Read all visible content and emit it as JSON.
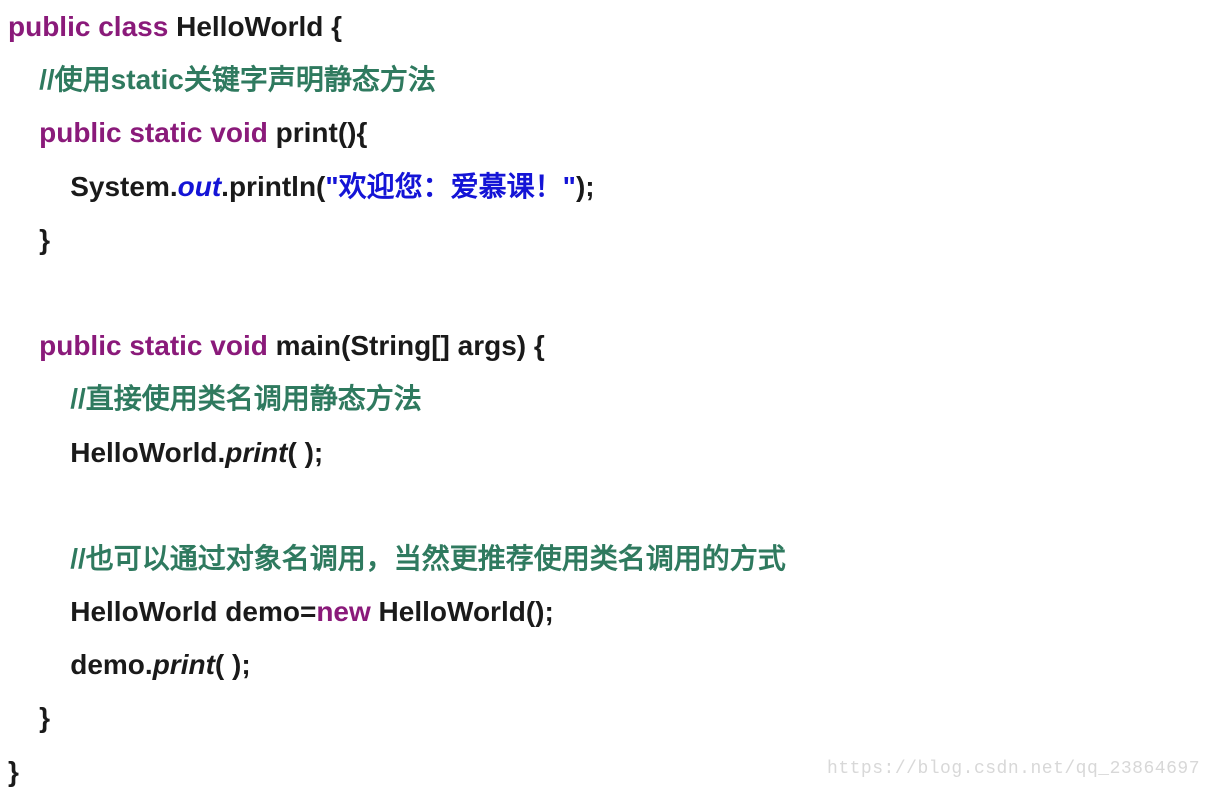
{
  "code": {
    "kw_public": "public",
    "kw_class": "class",
    "kw_static": "static",
    "kw_void": "void",
    "kw_new": "new",
    "cls_name": "HelloWorld",
    "brace_open": " {",
    "brace_close": "}",
    "comment1": "//使用static关键字声明静态方法",
    "print_decl_name": " print",
    "print_decl_tail": "(){",
    "sys": "System.",
    "out": "out",
    "println": ".println(",
    "string": "\"欢迎您：爱慕课！\"",
    "println_tail": ");",
    "main_name": " main",
    "main_params": "(String[] args) {",
    "comment2": "//直接使用类名调用静态方法",
    "call1_obj": "HelloWorld.",
    "call1_method": "print",
    "call1_tail": "( );",
    "comment3": "//也可以通过对象名调用，当然更推荐使用类名调用的方式",
    "demo_decl": "HelloWorld demo=",
    "demo_tail": " HelloWorld();",
    "call2_obj": "demo.",
    "call2_method": "print",
    "call2_tail": "( );"
  },
  "watermark": "https://blog.csdn.net/qq_23864697"
}
